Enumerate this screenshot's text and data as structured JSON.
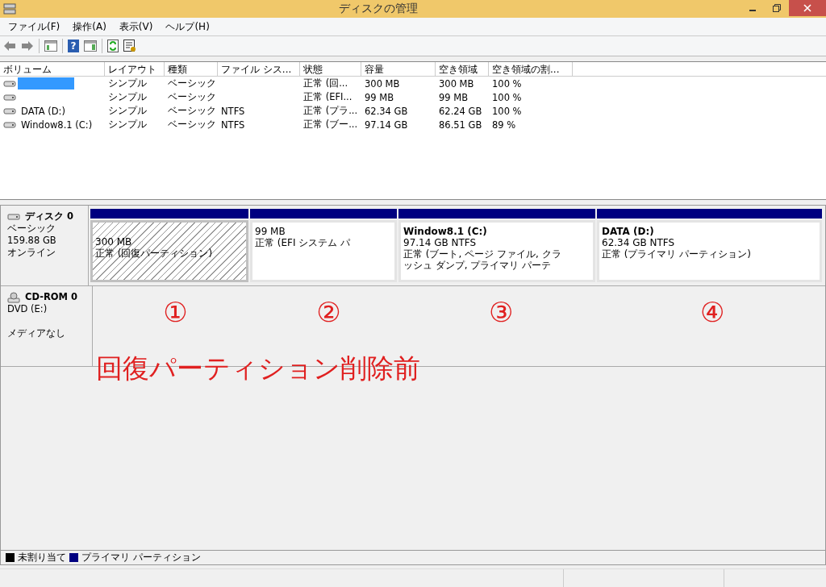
{
  "window": {
    "title": "ディスクの管理"
  },
  "menu": [
    {
      "label": "ファイル(F)"
    },
    {
      "label": "操作(A)"
    },
    {
      "label": "表示(V)"
    },
    {
      "label": "ヘルプ(H)"
    }
  ],
  "toolbar": {
    "help_glyph": "?"
  },
  "volume_table": {
    "columns": [
      "ボリューム",
      "レイアウト",
      "種類",
      "ファイル シス...",
      "状態",
      "容量",
      "空き領域",
      "空き領域の割..."
    ],
    "rows": [
      {
        "selected": true,
        "layout": "シンプル",
        "type": "ベーシック",
        "status": "正常 (回...",
        "capacity": "300 MB",
        "free": "300 MB",
        "free_pct": "100 %"
      },
      {
        "selected": false,
        "layout": "シンプル",
        "type": "ベーシック",
        "status": "正常 (EFI...",
        "capacity": "99 MB",
        "free": "99 MB",
        "free_pct": "100 %"
      },
      {
        "selected": false,
        "volume": "DATA (D:)",
        "layout": "シンプル",
        "type": "ベーシック",
        "file_system": "NTFS",
        "status": "正常 (プラ...",
        "capacity": "62.34 GB",
        "free": "62.24 GB",
        "free_pct": "100 %"
      },
      {
        "selected": false,
        "volume": "Window8.1 (C:)",
        "layout": "シンプル",
        "type": "ベーシック",
        "file_system": "NTFS",
        "status": "正常 (ブー...",
        "capacity": "97.14 GB",
        "free": "86.51 GB",
        "free_pct": "89 %"
      }
    ]
  },
  "disks": [
    {
      "kind": "disk",
      "name": "ディスク 0",
      "lines": [
        "ベーシック",
        "159.88 GB",
        "オンライン"
      ],
      "partitions": [
        {
          "selected": true,
          "size": "300 MB",
          "status": "正常 (回復パーティション)"
        },
        {
          "selected": false,
          "size": "99 MB",
          "status": "正常 (EFI システム パ"
        },
        {
          "selected": false,
          "title": "Window8.1  (C:)",
          "size": "97.14 GB NTFS",
          "status": "正常 (ブート, ページ ファイル, クラッシュ ダンプ, プライマリ パーテ"
        },
        {
          "selected": false,
          "title": "DATA  (D:)",
          "size": "62.34 GB NTFS",
          "status": "正常 (プライマリ パーティション)"
        }
      ]
    },
    {
      "kind": "cdrom",
      "name": "CD-ROM 0",
      "lines": [
        "DVD (E:)",
        "メディアなし"
      ]
    }
  ],
  "annotations": {
    "markers": [
      "①",
      "②",
      "③",
      "④"
    ],
    "caption": "回復パーティション削除前"
  },
  "legend": [
    {
      "label": "未割り当て",
      "color": "#000000"
    },
    {
      "label": "プライマリ パーティション",
      "color": "#000080"
    }
  ]
}
